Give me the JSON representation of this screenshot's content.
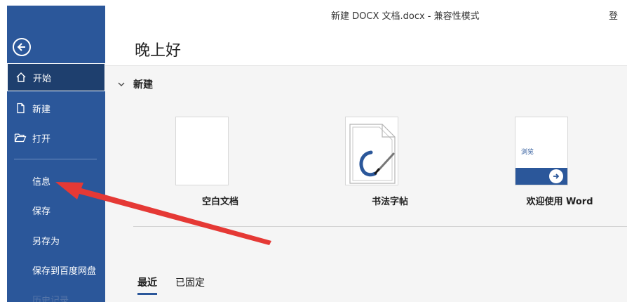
{
  "window": {
    "title": "新建 DOCX 文档.docx  -  兼容性模式",
    "title_edge": "登"
  },
  "sidebar": {
    "back_icon": "back-arrow-icon",
    "items": [
      {
        "label": "开始",
        "icon": "home-icon",
        "selected": true
      },
      {
        "label": "新建",
        "icon": "new-document-icon"
      },
      {
        "label": "打开",
        "icon": "open-folder-icon"
      }
    ],
    "text_items": [
      "信息",
      "保存",
      "另存为",
      "保存到百度网盘",
      "历史记录"
    ]
  },
  "main": {
    "greeting": "晚上好",
    "new_section": {
      "title": "新建",
      "templates": [
        {
          "label": "空白文档"
        },
        {
          "label": "书法字帖"
        },
        {
          "label": "欢迎使用 Word",
          "thumb_text": "浏览"
        }
      ]
    },
    "tabs": [
      {
        "label": "最近",
        "active": true
      },
      {
        "label": "已固定",
        "active": false
      }
    ]
  },
  "colors": {
    "sidebar": "#2b579a",
    "sidebar_selected": "#1e3f6e",
    "annotation_arrow": "#e53935"
  }
}
